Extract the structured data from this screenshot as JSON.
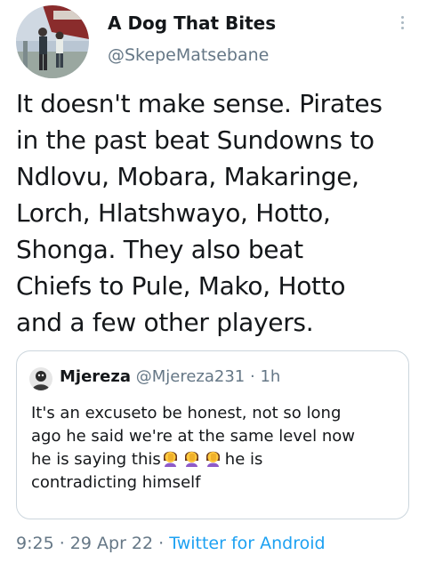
{
  "tweet": {
    "author": {
      "name": "A Dog That Bites",
      "handle": "@SkepeMatsebane"
    },
    "text_lines": [
      "It doesn't make sense. Pirates",
      "in the past beat Sundowns to",
      "Ndlovu, Mobara, Makaringe,",
      "Lorch, Hlatshwayo, Hotto,",
      "Shonga. They also beat",
      "Chiefs to Pule, Mako, Hotto",
      "and a few other players."
    ],
    "quoted": {
      "name": "Mjereza",
      "handle": "@Mjereza231",
      "separator": " · ",
      "time": "1h",
      "line1": "It's an excuseto be honest, not so long",
      "line2": "ago he said we're at the same level now",
      "line3_prefix": "he is saying this",
      "line3_suffix": "he is",
      "line4": "contradicting himself",
      "emoji_name": "woman-facepalming-emoji"
    },
    "meta": {
      "time": "9:25",
      "dot1": " · ",
      "date": "29 Apr 22",
      "dot2": " · ",
      "source": "Twitter for Android"
    }
  },
  "colors": {
    "text": "#14171a",
    "secondary": "#657786",
    "link": "#1da1f2",
    "border": "#ccd6dd"
  }
}
